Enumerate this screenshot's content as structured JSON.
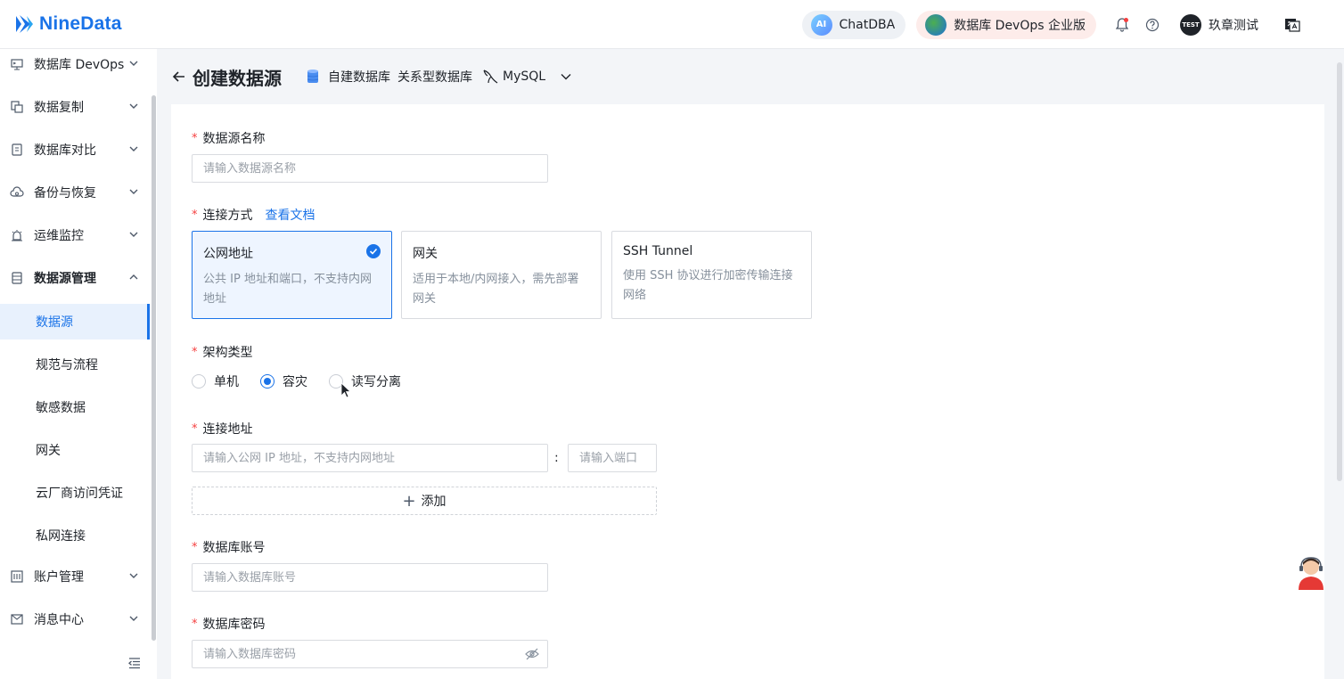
{
  "header": {
    "logo_text": "NineData",
    "chatdba_label": "ChatDBA",
    "chatdba_icon_text": "AI",
    "devops_label": "数据库 DevOps 企业版",
    "avatar_text": "TEST",
    "user_name": "玖章测试"
  },
  "sidebar": {
    "items": [
      {
        "label": "数据库 DevOps",
        "icon": "monitor-icon"
      },
      {
        "label": "数据复制",
        "icon": "copy-icon"
      },
      {
        "label": "数据库对比",
        "icon": "compare-icon"
      },
      {
        "label": "备份与恢复",
        "icon": "cloud-backup-icon"
      },
      {
        "label": "运维监控",
        "icon": "alarm-icon"
      },
      {
        "label": "数据源管理",
        "icon": "database-icon"
      }
    ],
    "sub_items": [
      "数据源",
      "规范与流程",
      "敏感数据",
      "网关",
      "云厂商访问凭证",
      "私网连接"
    ],
    "bottom_items": [
      {
        "label": "账户管理",
        "icon": "account-icon"
      },
      {
        "label": "消息中心",
        "icon": "mail-icon"
      }
    ]
  },
  "breadcrumb": {
    "title": "创建数据源",
    "env": "自建数据库",
    "category": "关系型数据库",
    "engine": "MySQL"
  },
  "form": {
    "name_label": "数据源名称",
    "name_placeholder": "请输入数据源名称",
    "conn_label": "连接方式",
    "doc_link": "查看文档",
    "cards": [
      {
        "title": "公网地址",
        "desc": "公共 IP 地址和端口，不支持内网地址",
        "selected": true
      },
      {
        "title": "网关",
        "desc": "适用于本地/内网接入，需先部署网关",
        "selected": false
      },
      {
        "title": "SSH Tunnel",
        "desc": "使用 SSH 协议进行加密传输连接网络",
        "selected": false
      }
    ],
    "arch_label": "架构类型",
    "arch_options": [
      {
        "label": "单机",
        "checked": false
      },
      {
        "label": "容灾",
        "checked": true
      },
      {
        "label": "读写分离",
        "checked": false
      }
    ],
    "addr_label": "连接地址",
    "addr_placeholder": "请输入公网 IP 地址，不支持内网地址",
    "colon": ":",
    "port_placeholder": "请输入端口",
    "add_label": "添加",
    "account_label": "数据库账号",
    "account_placeholder": "请输入数据库账号",
    "password_label": "数据库密码",
    "password_placeholder": "请输入数据库密码"
  },
  "colors": {
    "primary": "#1a73e8",
    "required": "#f53f3f",
    "selected_card_bg": "#eef5ff"
  }
}
